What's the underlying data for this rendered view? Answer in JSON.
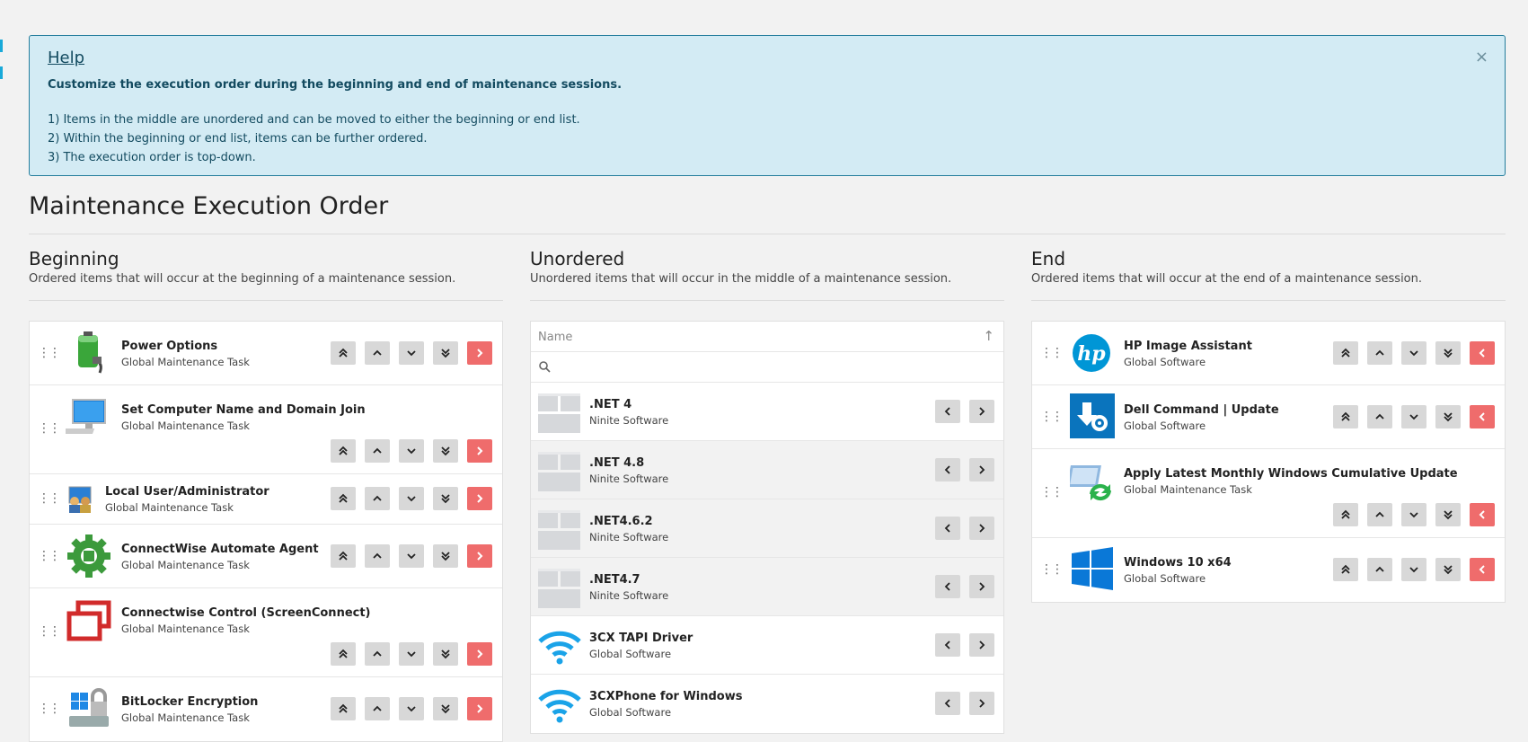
{
  "help": {
    "title": "Help",
    "close": "×",
    "subtitle": "Customize the execution order during the beginning and end of maintenance sessions.",
    "items": [
      "1) Items in the middle are unordered and can be moved to either the beginning or end list.",
      "2) Within the beginning or end list, items can be further ordered.",
      "3) The execution order is top-down."
    ]
  },
  "page": {
    "title": "Maintenance Execution Order"
  },
  "beginning": {
    "title": "Beginning",
    "description": "Ordered items that will occur at the beginning of a maintenance session.",
    "items": [
      {
        "name": "Power Options",
        "type": "Global Maintenance Task",
        "icon": "battery-plug-icon"
      },
      {
        "name": "Set Computer Name and Domain Join",
        "type": "Global Maintenance Task",
        "icon": "computer-monitor-icon"
      },
      {
        "name": "Local User/Administrator",
        "type": "Global Maintenance Task",
        "icon": "users-icon"
      },
      {
        "name": "ConnectWise Automate Agent",
        "type": "Global Maintenance Task",
        "icon": "gear-icon"
      },
      {
        "name": "Connectwise Control (ScreenConnect)",
        "type": "Global Maintenance Task",
        "icon": "screenconnect-icon"
      },
      {
        "name": "BitLocker Encryption",
        "type": "Global Maintenance Task",
        "icon": "bitlocker-icon"
      }
    ]
  },
  "unordered": {
    "title": "Unordered",
    "description": "Unordered items that will occur in the middle of a maintenance session.",
    "column_header": "Name",
    "sort_glyph": "↑",
    "search_placeholder": "",
    "items": [
      {
        "name": ".NET 4",
        "type": "Ninite Software",
        "icon": "package-icon"
      },
      {
        "name": ".NET 4.8",
        "type": "Ninite Software",
        "icon": "package-icon"
      },
      {
        "name": ".NET4.6.2",
        "type": "Ninite Software",
        "icon": "package-icon"
      },
      {
        "name": ".NET4.7",
        "type": "Ninite Software",
        "icon": "package-icon"
      },
      {
        "name": "3CX TAPI Driver",
        "type": "Global Software",
        "icon": "wifi-icon"
      },
      {
        "name": "3CXPhone for Windows",
        "type": "Global Software",
        "icon": "wifi-icon"
      }
    ]
  },
  "end": {
    "title": "End",
    "description": "Ordered items that will occur at the end of a maintenance session.",
    "items": [
      {
        "name": "HP Image Assistant",
        "type": "Global Software",
        "icon": "hp-logo-icon"
      },
      {
        "name": "Dell Command | Update",
        "type": "Global Software",
        "icon": "dell-command-icon"
      },
      {
        "name": "Apply Latest Monthly Windows Cumulative Update",
        "type": "Global Maintenance Task",
        "icon": "windows-update-icon"
      },
      {
        "name": "Windows 10 x64",
        "type": "Global Software",
        "icon": "windows-logo-icon"
      }
    ]
  },
  "colors": {
    "help_bg": "#d3ebf4",
    "help_border": "#257e9d",
    "move_button": "#ef6c6c",
    "order_button": "#d8d8d8"
  }
}
